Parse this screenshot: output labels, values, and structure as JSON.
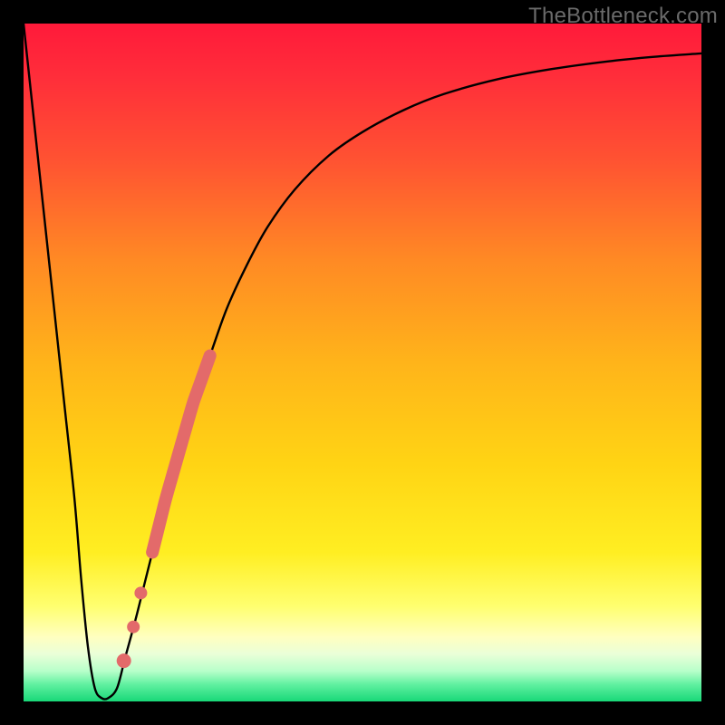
{
  "watermark": "TheBottleneck.com",
  "chart_data": {
    "type": "line",
    "title": "",
    "xlabel": "",
    "ylabel": "",
    "xlim": [
      0,
      100
    ],
    "ylim": [
      0,
      100
    ],
    "grid": false,
    "legend": false,
    "background_gradient": {
      "stops": [
        {
          "offset": 0.0,
          "color": "#ff1a3a"
        },
        {
          "offset": 0.08,
          "color": "#ff2e3a"
        },
        {
          "offset": 0.2,
          "color": "#ff5232"
        },
        {
          "offset": 0.35,
          "color": "#ff8a24"
        },
        {
          "offset": 0.5,
          "color": "#ffb41a"
        },
        {
          "offset": 0.65,
          "color": "#ffd414"
        },
        {
          "offset": 0.78,
          "color": "#ffee22"
        },
        {
          "offset": 0.86,
          "color": "#ffff70"
        },
        {
          "offset": 0.905,
          "color": "#ffffc0"
        },
        {
          "offset": 0.93,
          "color": "#eaffd8"
        },
        {
          "offset": 0.955,
          "color": "#b8ffca"
        },
        {
          "offset": 0.975,
          "color": "#60f0a0"
        },
        {
          "offset": 1.0,
          "color": "#18d878"
        }
      ]
    },
    "series": [
      {
        "name": "bottleneck-curve",
        "x": [
          0.0,
          1.5,
          3.0,
          4.5,
          6.0,
          7.5,
          8.5,
          9.5,
          10.5,
          11.5,
          12.5,
          13.8,
          15.0,
          16.5,
          18.0,
          19.5,
          21.0,
          23.0,
          25.0,
          27.5,
          30.0,
          33.0,
          36.0,
          40.0,
          45.0,
          50.0,
          56.0,
          62.0,
          70.0,
          78.0,
          86.0,
          93.0,
          100.0
        ],
        "y": [
          100.0,
          86.0,
          72.0,
          58.0,
          44.0,
          30.0,
          18.0,
          8.0,
          2.0,
          0.5,
          0.5,
          2.0,
          6.5,
          12.0,
          18.0,
          24.0,
          30.0,
          37.0,
          44.0,
          51.0,
          58.0,
          64.5,
          70.0,
          75.5,
          80.5,
          84.0,
          87.2,
          89.6,
          91.8,
          93.3,
          94.4,
          95.1,
          95.6
        ]
      }
    ],
    "highlights": {
      "name": "thick-segment",
      "x": [
        19.0,
        27.5
      ],
      "y": [
        22.0,
        51.0
      ],
      "color": "#e36a6a",
      "width": 14
    },
    "dots": [
      {
        "x": 17.3,
        "y": 16.0,
        "r": 7,
        "color": "#e36a6a"
      },
      {
        "x": 16.2,
        "y": 11.0,
        "r": 7,
        "color": "#e36a6a"
      },
      {
        "x": 14.8,
        "y": 6.0,
        "r": 8,
        "color": "#e36a6a"
      }
    ]
  }
}
